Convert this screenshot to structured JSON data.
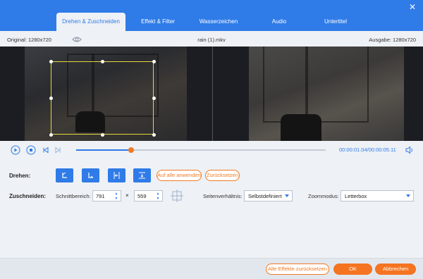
{
  "window": {
    "close_label": "✕"
  },
  "tabs": [
    {
      "label": "Drehen & Zuschneiden",
      "active": true
    },
    {
      "label": "Effekt & Filter",
      "active": false
    },
    {
      "label": "Wasserzeichen",
      "active": false
    },
    {
      "label": "Audio",
      "active": false
    },
    {
      "label": "Untertitel",
      "active": false
    }
  ],
  "info": {
    "original": "Original: 1280x720",
    "filename": "rain (1).mkv",
    "output": "Ausgabe: 1280x720"
  },
  "playback": {
    "current_time": "00:00:01.04",
    "total_time": "/00:00:05.11",
    "progress": 0.22
  },
  "rotate": {
    "label": "Drehen:",
    "buttons": [
      {
        "icon": "rotate-left-icon"
      },
      {
        "icon": "rotate-right-icon"
      },
      {
        "icon": "flip-horizontal-icon"
      },
      {
        "icon": "flip-vertical-icon"
      }
    ],
    "apply_all": "Auf alle anwenden",
    "reset": "Zurücksetzen"
  },
  "crop": {
    "label": "Zuschneiden:",
    "area_label": "Schnittbereich:",
    "width": "791",
    "times": "×",
    "height": "559",
    "aspect_label": "Seitenverhältnis:",
    "aspect_value": "Selbstdefiniert",
    "zoom_label": "Zoommodus:",
    "zoom_value": "Letterbox"
  },
  "footer": {
    "reset_all": "Alle Effekte zurücksetzen",
    "ok": "OK",
    "cancel": "Abbrechen"
  },
  "colors": {
    "accent_blue": "#2f7be8",
    "accent_orange": "#f47421",
    "crop_frame": "#e8d83a"
  }
}
